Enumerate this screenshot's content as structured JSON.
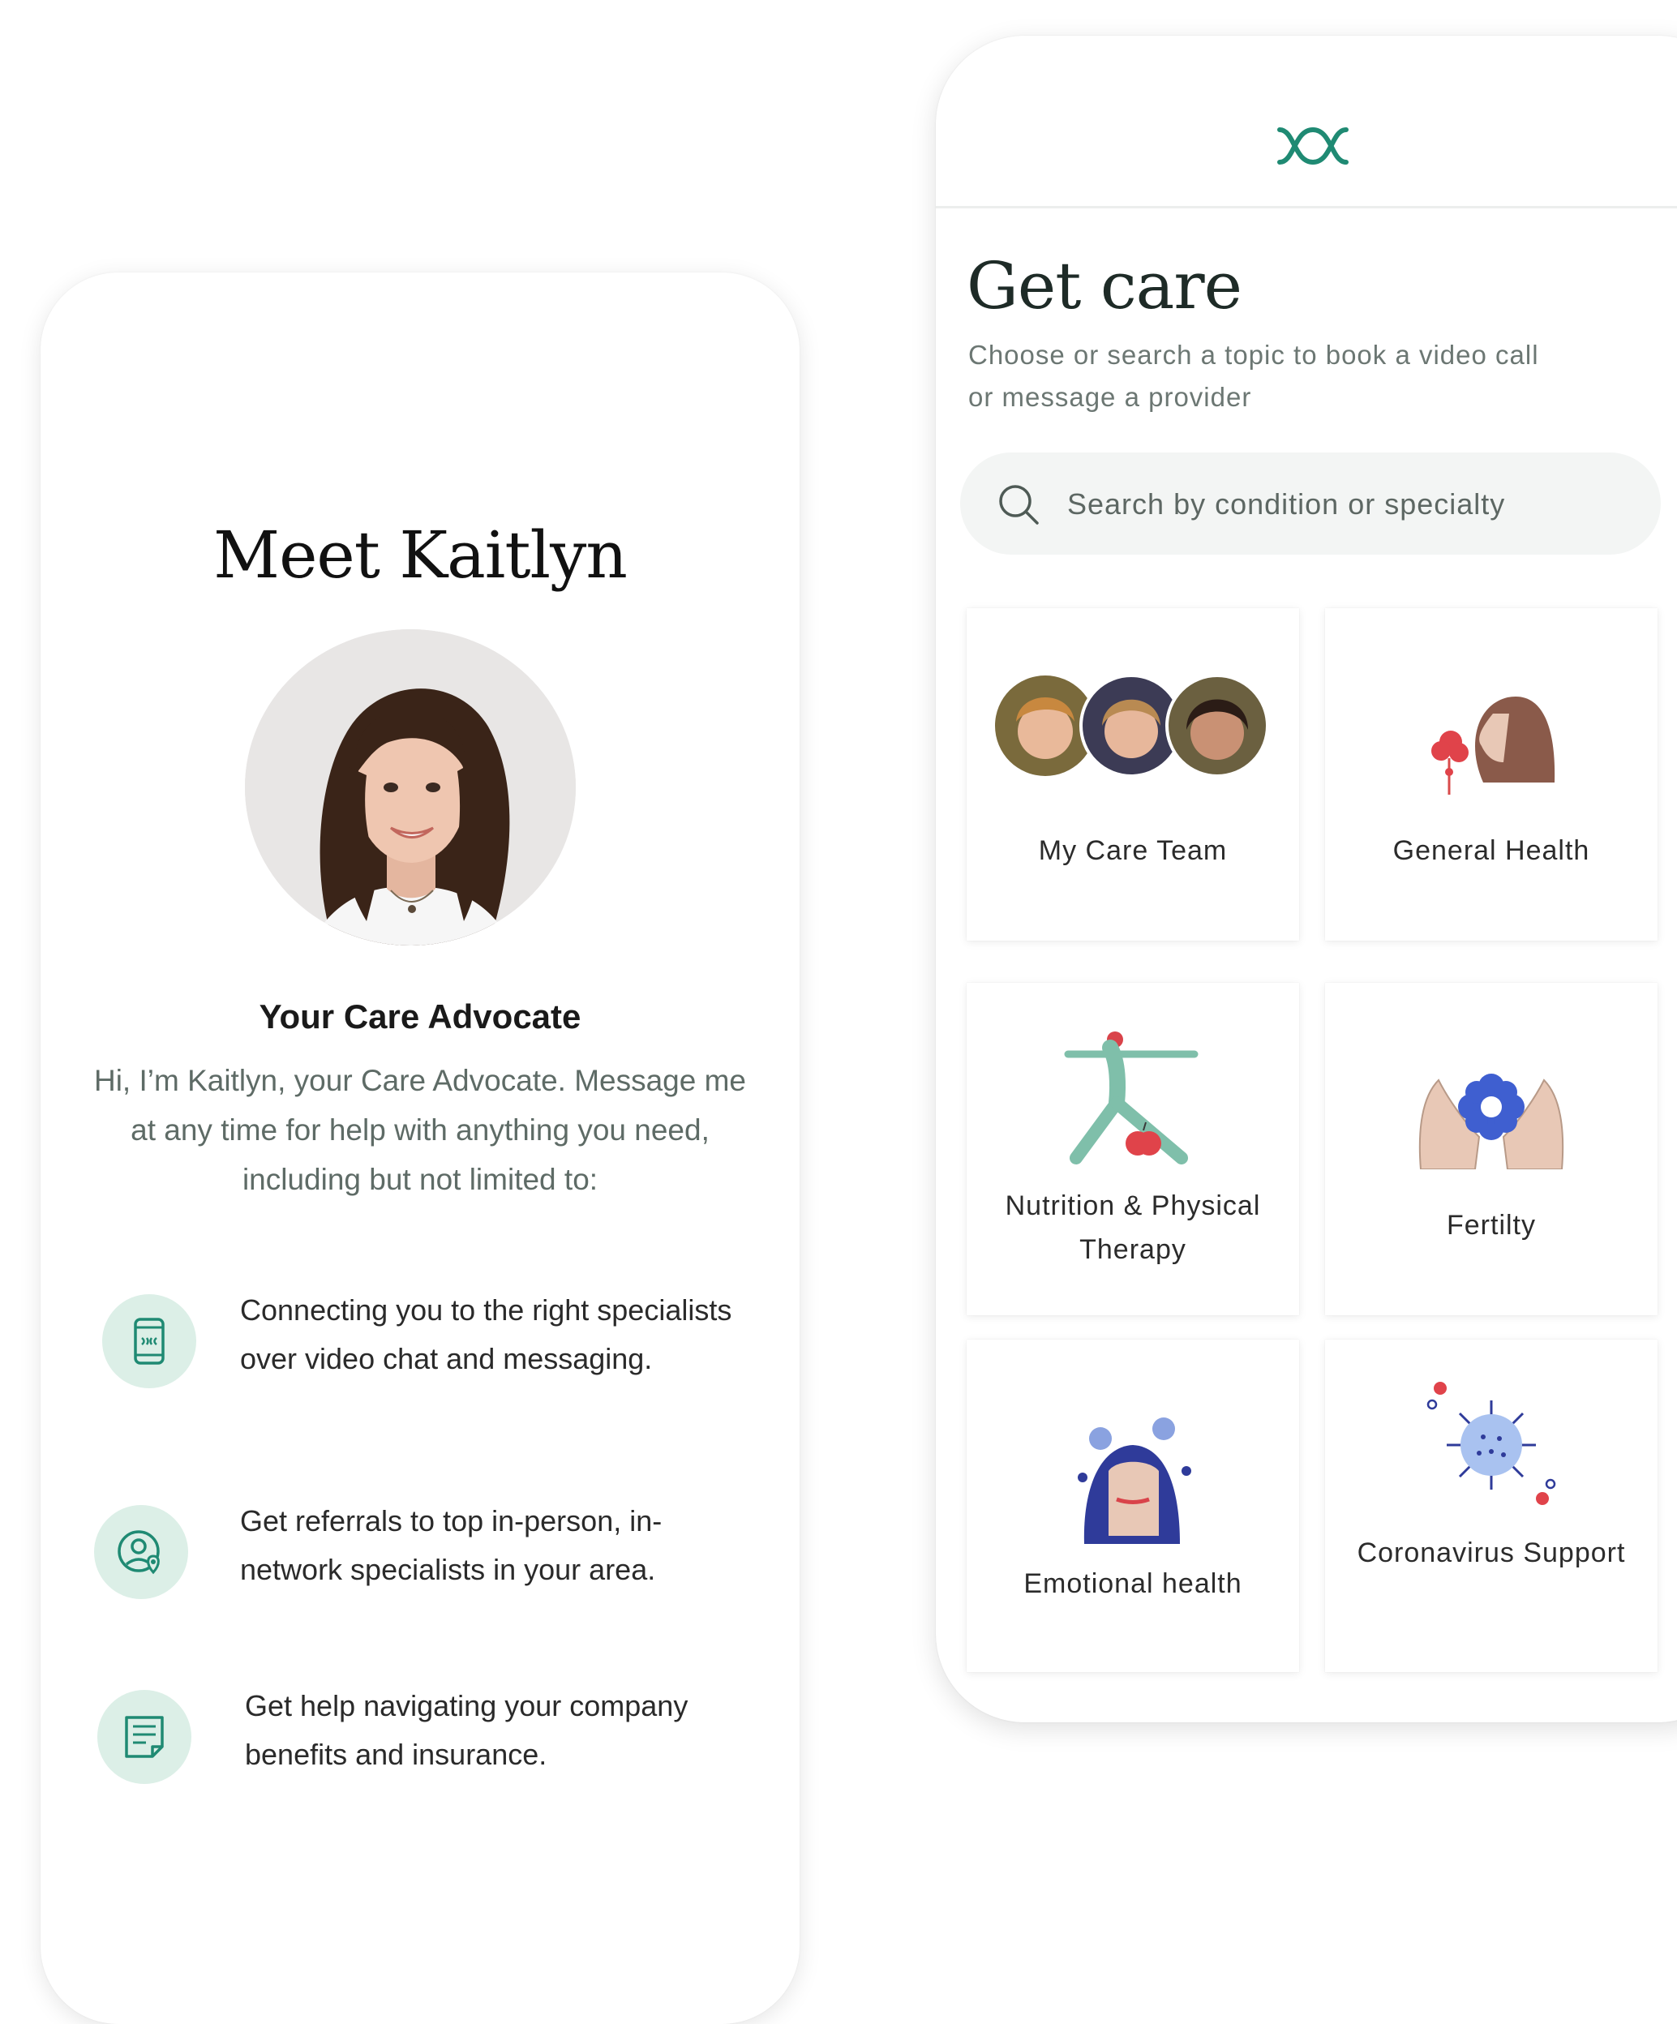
{
  "advocate_card": {
    "title": "Meet Kaitlyn",
    "role": "Your Care Advocate",
    "intro": "Hi, I’m Kaitlyn, your Care Advocate. Message me at any time for help with anything you need, including but not limited to:",
    "features": [
      {
        "icon": "phone-icon",
        "text": "Connecting you to the right specialists over video chat and messaging."
      },
      {
        "icon": "user-location-icon",
        "text": "Get referrals to top in-person, in-network specialists in your area."
      },
      {
        "icon": "document-icon",
        "text": "Get help navigating your company benefits and insurance."
      }
    ]
  },
  "get_care": {
    "logo": "maven-logo-icon",
    "title": "Get care",
    "subtitle": "Choose or search a topic to book a video call or message a provider",
    "search": {
      "placeholder": "Search by condition or specialty",
      "value": ""
    },
    "tiles": [
      {
        "label": "My Care Team",
        "icon": "care-team-avatars"
      },
      {
        "label": "General Health",
        "icon": "woman-smelling-flower-icon"
      },
      {
        "label": "Nutrition & Physical Therapy",
        "icon": "stretching-figure-icon"
      },
      {
        "label": "Fertilty",
        "icon": "hands-flower-icon"
      },
      {
        "label": "Emotional health",
        "icon": "woman-portrait-icon"
      },
      {
        "label": "Coronavirus Support",
        "icon": "virus-icon"
      }
    ]
  },
  "colors": {
    "brand_green": "#1f8a73",
    "icon_bg": "#dcefe7",
    "muted_text": "#5e6b66"
  }
}
